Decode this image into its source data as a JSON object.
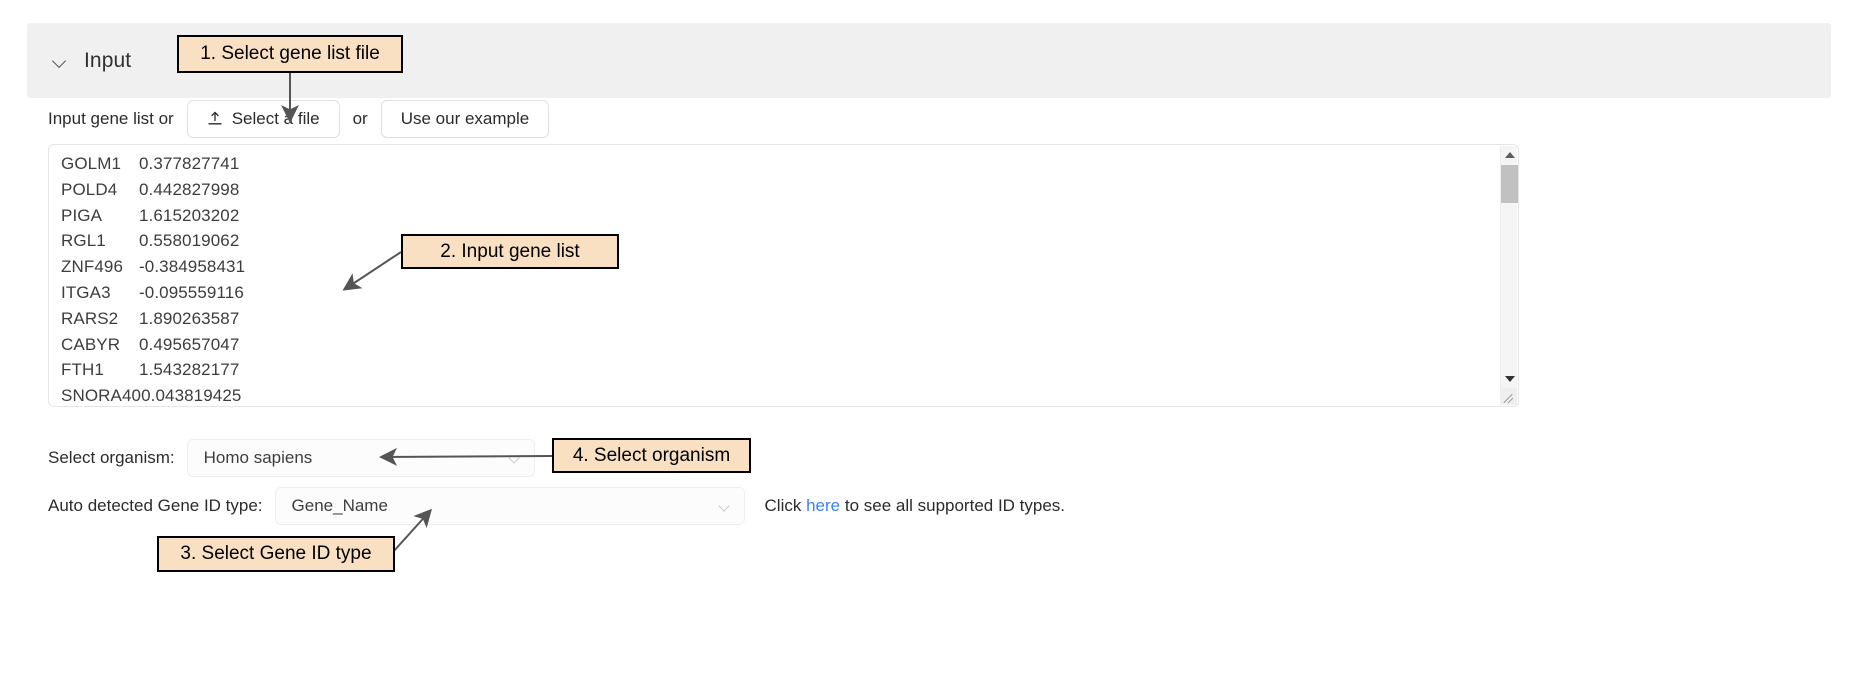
{
  "panel": {
    "title": "Input",
    "collapse_icon": "chevron-down-icon"
  },
  "file_row": {
    "label": "Input gene list or",
    "select_file_button": "Select a file",
    "select_file_icon": "upload-icon",
    "or_text": "or",
    "example_button": "Use our example"
  },
  "gene_list": {
    "rows": [
      {
        "gene": "GOLM1",
        "value": "0.377827741"
      },
      {
        "gene": "POLD4",
        "value": "0.442827998"
      },
      {
        "gene": "PIGA",
        "value": "1.615203202"
      },
      {
        "gene": "RGL1",
        "value": "0.558019062"
      },
      {
        "gene": "ZNF496",
        "value": "-0.384958431"
      },
      {
        "gene": "ITGA3",
        "value": "-0.095559116"
      },
      {
        "gene": "RARS2",
        "value": "1.890263587"
      },
      {
        "gene": "CABYR",
        "value": "0.495657047"
      },
      {
        "gene": "FTH1",
        "value": "1.543282177"
      },
      {
        "gene": "SNORA40",
        "value": "0.043819425"
      }
    ],
    "scroll_up_icon": "scroll-up-arrow-icon",
    "scroll_down_icon": "scroll-down-arrow-icon",
    "resize_icon": "resize-grip-icon"
  },
  "organism": {
    "label": "Select organism:",
    "value": "Homo sapiens",
    "caret_icon": "chevron-down-icon"
  },
  "gene_id_type": {
    "label": "Auto detected Gene ID type:",
    "value": "Gene_Name",
    "caret_icon": "chevron-down-icon",
    "hint_prefix": "Click ",
    "hint_link": "here",
    "hint_suffix": " to see all supported ID types."
  },
  "callouts": [
    {
      "id": 1,
      "text": "1. Select gene list file"
    },
    {
      "id": 2,
      "text": "2. Input gene list"
    },
    {
      "id": 3,
      "text": "3. Select Gene ID type"
    },
    {
      "id": 4,
      "text": "4. Select organism"
    }
  ],
  "colors": {
    "callout_fill": "#fae0c3",
    "callout_border": "#000000",
    "header_bg": "#f0f0f0",
    "link": "#3b82f6"
  }
}
